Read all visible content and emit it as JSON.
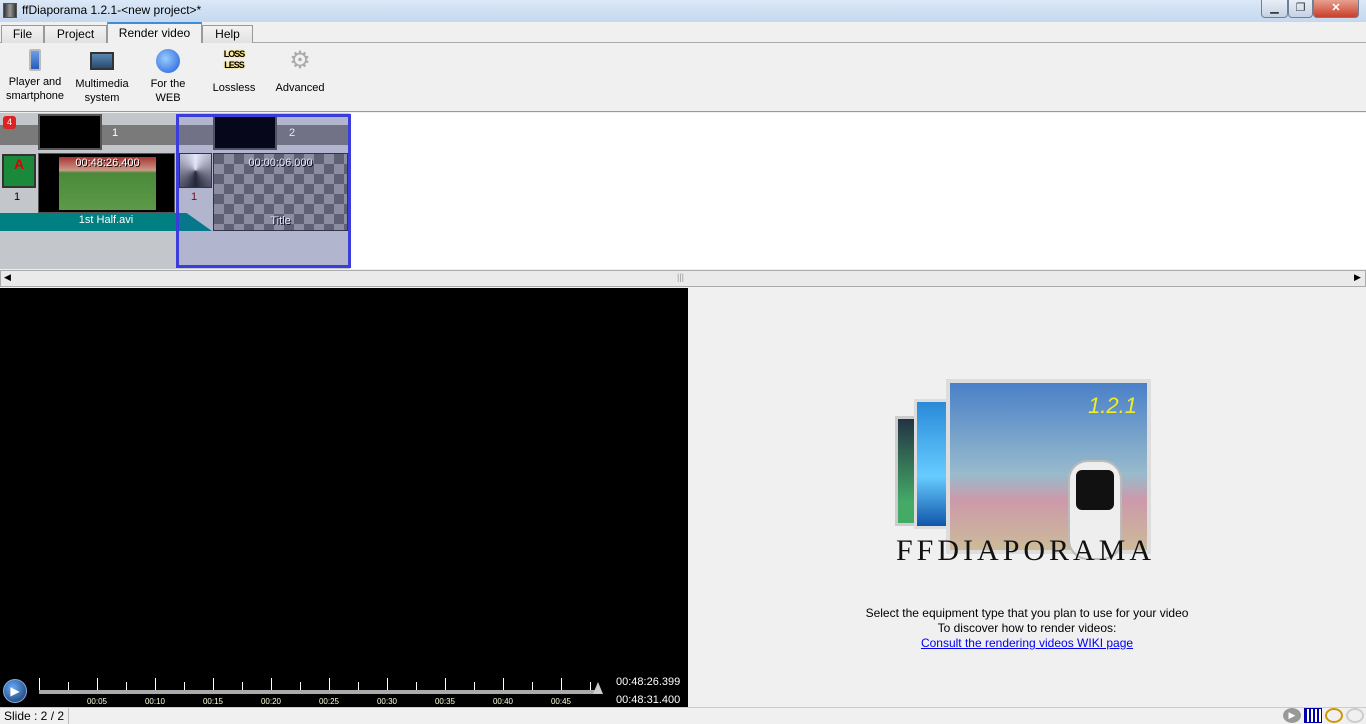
{
  "window": {
    "title": "ffDiaporama 1.2.1-<new project>*",
    "controls": [
      "minimize",
      "restore",
      "close"
    ]
  },
  "tabs": [
    {
      "label": "File"
    },
    {
      "label": "Project"
    },
    {
      "label": "Render video",
      "active": true
    },
    {
      "label": "Help"
    }
  ],
  "toolbar": [
    {
      "label1": "Player and",
      "label2": "smartphone",
      "icon": "smartphone-icon"
    },
    {
      "label1": "Multimedia",
      "label2": "system",
      "icon": "monitor-icon"
    },
    {
      "label1": "For the",
      "label2": "WEB",
      "icon": "globe-icon"
    },
    {
      "label1": "Lossless",
      "label2": "",
      "icon": "lossless-icon",
      "badge": "LOSS LESS"
    },
    {
      "label1": "Advanced",
      "label2": "",
      "icon": "gear-icon"
    }
  ],
  "timeline": {
    "slides": [
      {
        "number": "1",
        "duration": "00:48:26.400",
        "name": "1st Half.avi",
        "transition_number": "1"
      },
      {
        "number": "2",
        "duration": "00:00:06.000",
        "name": "Title",
        "transition_number": "1",
        "selected": true
      }
    ]
  },
  "player": {
    "ticks": [
      "00:05",
      "00:10",
      "00:15",
      "00:20",
      "00:25",
      "00:30",
      "00:35",
      "00:40",
      "00:45"
    ],
    "current_time": "00:48:26.399",
    "total_time": "00:48:31.400",
    "progress": 0.998
  },
  "info": {
    "logo_text": "FFDIAPORAMA",
    "version": "1.2.1",
    "line1": "Select the equipment type that you plan to use for your video",
    "line2": "To discover how to render videos:",
    "link": "Consult the rendering videos WIKI page"
  },
  "status": {
    "slide": "Slide : 2 / 2"
  },
  "colors": {
    "selection": "#3c3cdc",
    "teal": "#008080",
    "link": "#0000ee"
  }
}
